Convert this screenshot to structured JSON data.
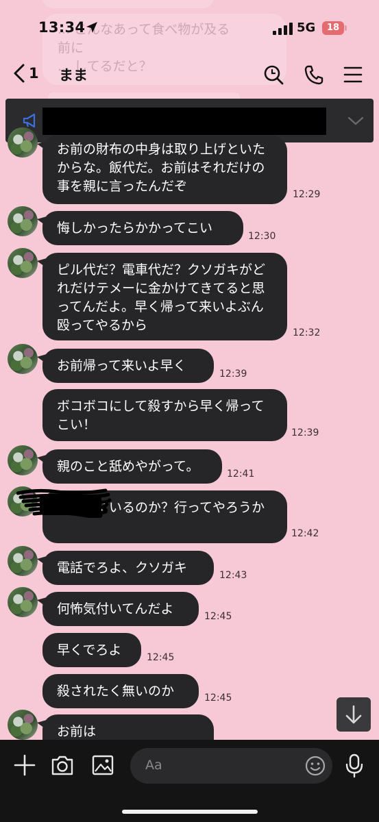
{
  "status_bar": {
    "time": "13:34",
    "network": "5G",
    "battery": "18"
  },
  "header": {
    "back_count": "1",
    "title": "まま"
  },
  "ghost": {
    "text": "... こんなあって食べ物が及る\n前に\n... してるだと？"
  },
  "messages": [
    {
      "text": "お前の財布の中身は取り上げといたからな。飯代だ。お前はそれだけの事を親に言ったんだぞ",
      "time": "12:29"
    },
    {
      "text": "悔しかったらかかってこい",
      "time": "12:30"
    },
    {
      "text": "ピル代だ？電車代だ？クソガキがどれだけテメーに金かけてきてると思ってんだよ。早く帰って来いよぶん殴ってやるから",
      "time": "12:32"
    },
    {
      "text": "お前帰って来いよ早く",
      "time": "12:39"
    },
    {
      "text": "ボコボコにして殺すから早く帰ってこい！",
      "time": "12:39"
    },
    {
      "text": "親のこと舐めやがって。",
      "time": "12:41"
    },
    {
      "text": "にいるのか？行ってやろうか",
      "time": "12:42"
    },
    {
      "text": "電話でろよ、クソガキ",
      "time": "12:43"
    },
    {
      "text": "何怖気付いてんだよ",
      "time": "12:45"
    },
    {
      "text": "早くでろよ",
      "time": "12:45"
    },
    {
      "text": "殺されたく無いのか",
      "time": "12:45"
    },
    {
      "text": "お前は",
      "time": ""
    }
  ],
  "input": {
    "placeholder": "Aa"
  },
  "icons": {
    "location": "location-arrow-icon",
    "search": "search-icon",
    "call": "phone-icon",
    "menu": "menu-icon",
    "announcement": "megaphone-icon",
    "expand": "chevron-down-icon",
    "scroll": "arrow-down-icon",
    "add": "plus-icon",
    "camera": "camera-icon",
    "image": "image-icon",
    "emoji": "emoji-icon",
    "voice": "microphone-icon"
  },
  "colors": {
    "background": "#f7c9d7",
    "bubble": "#262628",
    "bottom_bar": "#141414",
    "battery": "#e46b6f"
  }
}
